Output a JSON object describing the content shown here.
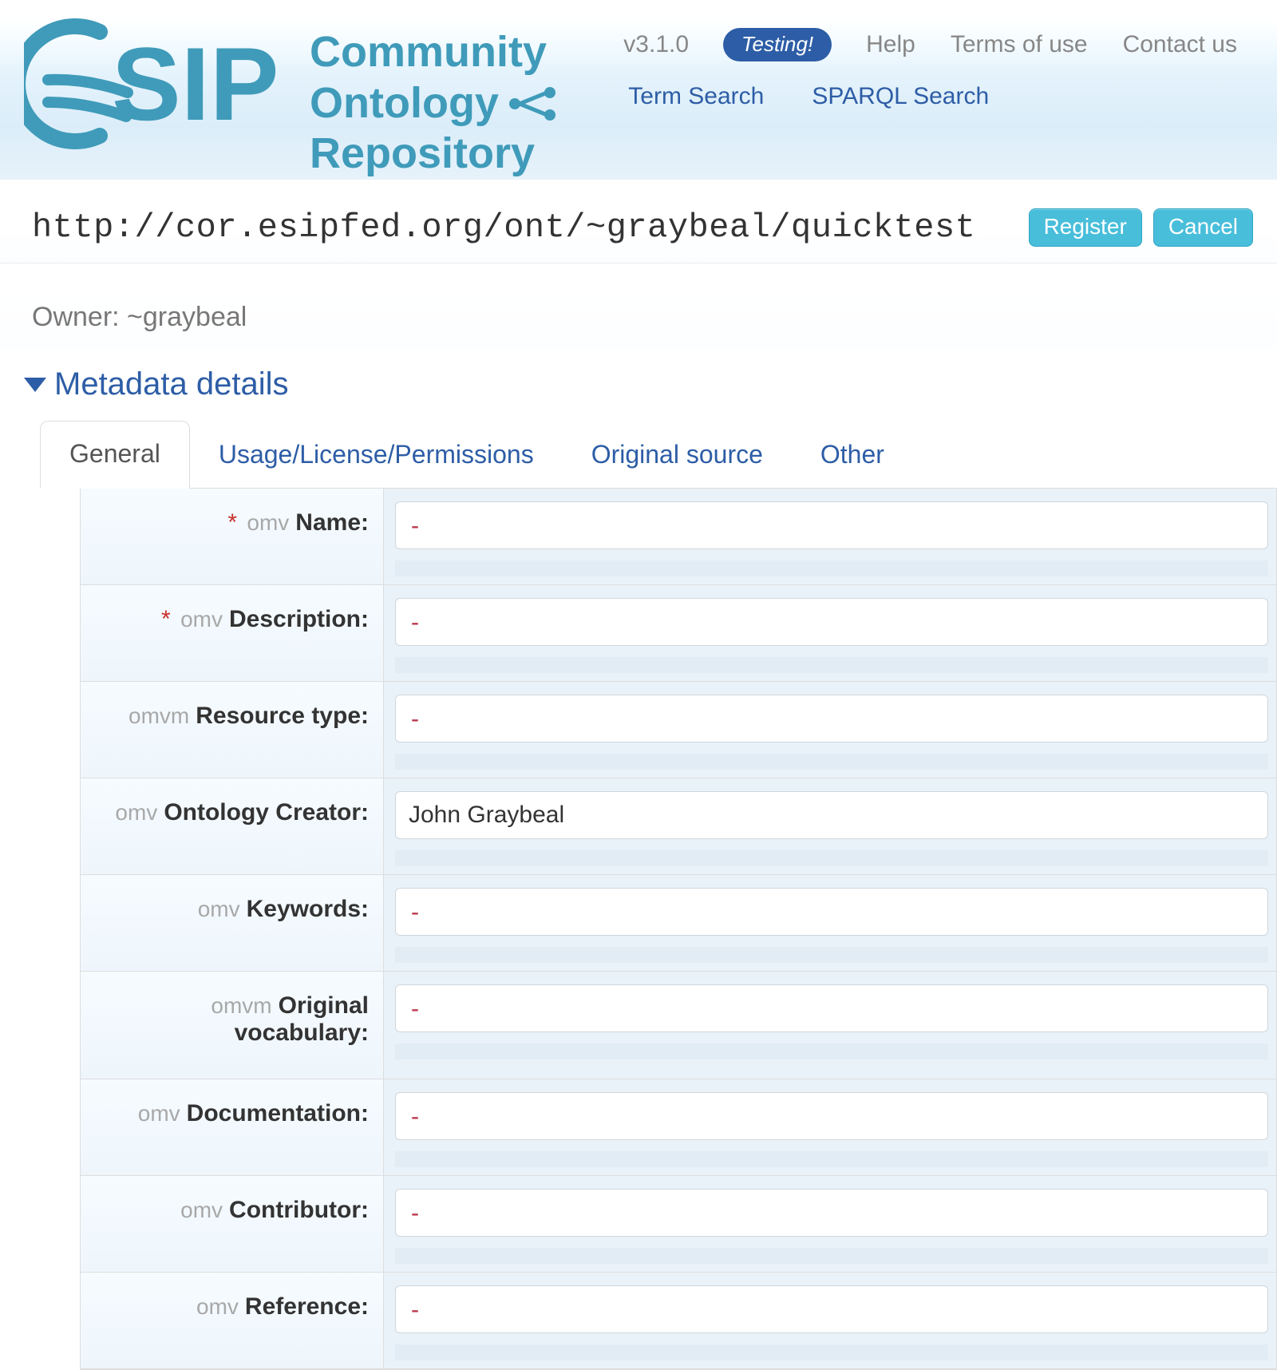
{
  "brand": {
    "line1": "Community",
    "line2": "Ontology",
    "line3": "Repository"
  },
  "header": {
    "version": "v3.1.0",
    "testing_badge": "Testing!",
    "help": "Help",
    "terms": "Terms of use",
    "contact": "Contact us",
    "term_search": "Term Search",
    "sparql_search": "SPARQL Search"
  },
  "actions": {
    "url": "http://cor.esipfed.org/ont/~graybeal/quicktest",
    "register": "Register",
    "cancel": "Cancel"
  },
  "owner": {
    "label": "Owner: ",
    "value": "~graybeal"
  },
  "section": {
    "title": "Metadata details"
  },
  "tabs": {
    "general": "General",
    "usage": "Usage/License/Permissions",
    "source": "Original source",
    "other": "Other"
  },
  "placeholders": {
    "dash": "-"
  },
  "fields": [
    {
      "required": true,
      "ns": "omv",
      "label": "Name:",
      "value": ""
    },
    {
      "required": true,
      "ns": "omv",
      "label": "Description:",
      "value": ""
    },
    {
      "required": false,
      "ns": "omvm",
      "label": "Resource type:",
      "value": ""
    },
    {
      "required": false,
      "ns": "omv",
      "label": "Ontology Creator:",
      "value": "John Graybeal"
    },
    {
      "required": false,
      "ns": "omv",
      "label": "Keywords:",
      "value": ""
    },
    {
      "required": false,
      "ns": "omvm",
      "label": "Original vocabulary:",
      "value": ""
    },
    {
      "required": false,
      "ns": "omv",
      "label": "Documentation:",
      "value": ""
    },
    {
      "required": false,
      "ns": "omv",
      "label": "Contributor:",
      "value": ""
    },
    {
      "required": false,
      "ns": "omv",
      "label": "Reference:",
      "value": ""
    }
  ]
}
